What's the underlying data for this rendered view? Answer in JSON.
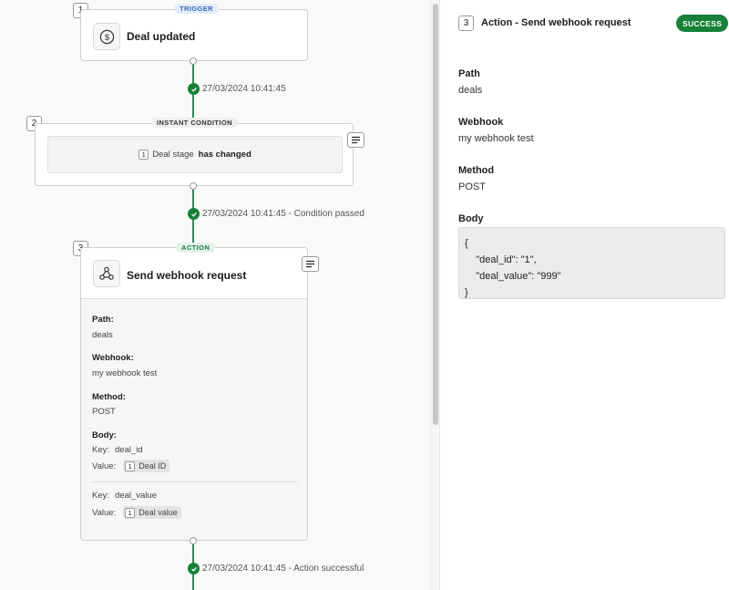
{
  "flow": {
    "trigger": {
      "number": "1",
      "badge": "TRIGGER",
      "title": "Deal updated",
      "status": "27/03/2024 10:41:45"
    },
    "condition": {
      "number": "2",
      "badge": "INSTANT CONDITION",
      "ref_number": "1",
      "field": "Deal stage",
      "operator": "has changed",
      "status": "27/03/2024 10:41:45 - Condition passed"
    },
    "action": {
      "number": "3",
      "badge": "ACTION",
      "title": "Send webhook request",
      "path_label": "Path:",
      "path_value": "deals",
      "webhook_label": "Webhook:",
      "webhook_value": "my webhook test",
      "method_label": "Method:",
      "method_value": "POST",
      "body_label": "Body:",
      "body_items": [
        {
          "key_label": "Key:",
          "key": "deal_id",
          "value_label": "Value:",
          "value_num": "1",
          "value": "Deal ID"
        },
        {
          "key_label": "Key:",
          "key": "deal_value",
          "value_label": "Value:",
          "value_num": "1",
          "value": "Deal value"
        }
      ],
      "status": "27/03/2024 10:41:45 - Action successful"
    }
  },
  "panel": {
    "number": "3",
    "title": "Action - Send webhook request",
    "status_badge": "SUCCESS",
    "path_label": "Path",
    "path_value": "deals",
    "webhook_label": "Webhook",
    "webhook_value": "my webhook test",
    "method_label": "Method",
    "method_value": "POST",
    "body_label": "Body",
    "body_code": "{\n    \"deal_id\": \"1\",\n    \"deal_value\": \"999\"\n}"
  },
  "colors": {
    "success": "#188038",
    "connector": "#2e8b57",
    "trigger_badge_bg": "#e3edf9",
    "trigger_badge_fg": "#3568b0",
    "action_badge_bg": "#e2f2e8",
    "action_badge_fg": "#1f7a45"
  },
  "icons": {
    "trigger": "dollar-circle-icon",
    "action": "webhook-icon",
    "notes": "notes-icon",
    "status": "check-circle-icon"
  }
}
